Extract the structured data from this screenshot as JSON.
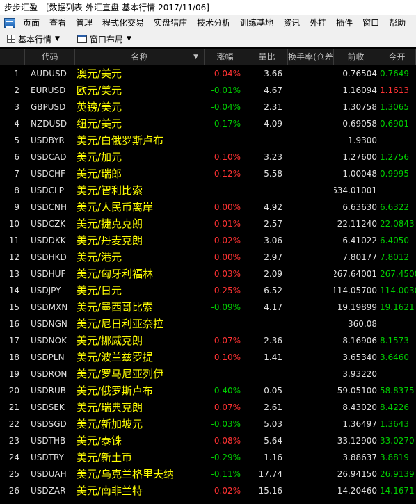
{
  "window": {
    "title": "步步汇盈 - [数据列表-外汇直盘-基本行情 2017/11/06]"
  },
  "menu": {
    "items": [
      "页面",
      "查看",
      "管理",
      "程式化交易",
      "实盘猎庄",
      "技术分析",
      "训练基地",
      "资讯",
      "外挂",
      "插件",
      "窗口",
      "帮助"
    ]
  },
  "toolbar": {
    "quote_label": "基本行情",
    "layout_label": "窗口布局"
  },
  "table": {
    "headers": {
      "code": "代码",
      "name": "名称",
      "change_pct": "涨幅",
      "volume_ratio": "量比",
      "swap": "换手率(仓差",
      "prev_close": "前收",
      "open": "今开"
    },
    "rows": [
      {
        "idx": "1",
        "code": "AUDUSD",
        "name": "澳元/美元",
        "chg": "0.04%",
        "dir": "up",
        "vr": "3.66",
        "prev": "0.76504",
        "open": "0.7649",
        "odir": "down"
      },
      {
        "idx": "2",
        "code": "EURUSD",
        "name": "欧元/美元",
        "chg": "-0.01%",
        "dir": "down",
        "vr": "4.67",
        "prev": "1.16094",
        "open": "1.1613",
        "odir": "up"
      },
      {
        "idx": "3",
        "code": "GBPUSD",
        "name": "英镑/美元",
        "chg": "-0.04%",
        "dir": "down",
        "vr": "2.31",
        "prev": "1.30758",
        "open": "1.3065",
        "odir": "down"
      },
      {
        "idx": "4",
        "code": "NZDUSD",
        "name": "纽元/美元",
        "chg": "-0.17%",
        "dir": "down",
        "vr": "4.09",
        "prev": "0.69058",
        "open": "0.6901",
        "odir": "down"
      },
      {
        "idx": "5",
        "code": "USDBYR",
        "name": "美元/白俄罗斯卢布",
        "chg": "",
        "dir": "flat",
        "vr": "",
        "prev": "1.9300",
        "open": "",
        "odir": "flat"
      },
      {
        "idx": "6",
        "code": "USDCAD",
        "name": "美元/加元",
        "chg": "0.10%",
        "dir": "up",
        "vr": "3.23",
        "prev": "1.27600",
        "open": "1.2756",
        "odir": "down"
      },
      {
        "idx": "7",
        "code": "USDCHF",
        "name": "美元/瑞郎",
        "chg": "0.12%",
        "dir": "up",
        "vr": "5.58",
        "prev": "1.00048",
        "open": "0.9995",
        "odir": "down"
      },
      {
        "idx": "8",
        "code": "USDCLP",
        "name": "美元/智利比索",
        "chg": "",
        "dir": "flat",
        "vr": "",
        "prev": "634.01001",
        "open": "",
        "odir": "flat"
      },
      {
        "idx": "9",
        "code": "USDCNH",
        "name": "美元/人民币离岸",
        "chg": "0.00%",
        "dir": "up",
        "vr": "4.92",
        "prev": "6.63630",
        "open": "6.6322",
        "odir": "down"
      },
      {
        "idx": "10",
        "code": "USDCZK",
        "name": "美元/捷克克朗",
        "chg": "0.01%",
        "dir": "up",
        "vr": "2.57",
        "prev": "22.11240",
        "open": "22.0843",
        "odir": "down"
      },
      {
        "idx": "11",
        "code": "USDDKK",
        "name": "美元/丹麦克朗",
        "chg": "0.02%",
        "dir": "up",
        "vr": "3.06",
        "prev": "6.41022",
        "open": "6.4050",
        "odir": "down"
      },
      {
        "idx": "12",
        "code": "USDHKD",
        "name": "美元/港元",
        "chg": "0.00%",
        "dir": "up",
        "vr": "2.97",
        "prev": "7.80177",
        "open": "7.8012",
        "odir": "down"
      },
      {
        "idx": "13",
        "code": "USDHUF",
        "name": "美元/匈牙利福林",
        "chg": "0.03%",
        "dir": "up",
        "vr": "2.09",
        "prev": "267.64001",
        "open": "267.4500",
        "odir": "down"
      },
      {
        "idx": "14",
        "code": "USDJPY",
        "name": "美元/日元",
        "chg": "0.25%",
        "dir": "up",
        "vr": "6.52",
        "prev": "114.05700",
        "open": "114.0030",
        "odir": "down"
      },
      {
        "idx": "15",
        "code": "USDMXN",
        "name": "美元/墨西哥比索",
        "chg": "-0.09%",
        "dir": "down",
        "vr": "4.17",
        "prev": "19.19899",
        "open": "19.1621",
        "odir": "down"
      },
      {
        "idx": "16",
        "code": "USDNGN",
        "name": "美元/尼日利亚奈拉",
        "chg": "",
        "dir": "flat",
        "vr": "",
        "prev": "360.08",
        "open": "",
        "odir": "flat"
      },
      {
        "idx": "17",
        "code": "USDNOK",
        "name": "美元/挪威克朗",
        "chg": "0.07%",
        "dir": "up",
        "vr": "2.36",
        "prev": "8.16906",
        "open": "8.1573",
        "odir": "down"
      },
      {
        "idx": "18",
        "code": "USDPLN",
        "name": "美元/波兰兹罗提",
        "chg": "0.10%",
        "dir": "up",
        "vr": "1.41",
        "prev": "3.65340",
        "open": "3.6460",
        "odir": "down"
      },
      {
        "idx": "19",
        "code": "USDRON",
        "name": "美元/罗马尼亚列伊",
        "chg": "",
        "dir": "flat",
        "vr": "",
        "prev": "3.93220",
        "open": "",
        "odir": "flat"
      },
      {
        "idx": "20",
        "code": "USDRUB",
        "name": "美元/俄罗斯卢布",
        "chg": "-0.40%",
        "dir": "down",
        "vr": "0.05",
        "prev": "59.05100",
        "open": "58.8375",
        "odir": "down"
      },
      {
        "idx": "21",
        "code": "USDSEK",
        "name": "美元/瑞典克朗",
        "chg": "0.07%",
        "dir": "up",
        "vr": "2.61",
        "prev": "8.43020",
        "open": "8.4226",
        "odir": "down"
      },
      {
        "idx": "22",
        "code": "USDSGD",
        "name": "美元/新加坡元",
        "chg": "-0.03%",
        "dir": "down",
        "vr": "5.03",
        "prev": "1.36497",
        "open": "1.3643",
        "odir": "down"
      },
      {
        "idx": "23",
        "code": "USDTHB",
        "name": "美元/泰铢",
        "chg": "0.08%",
        "dir": "up",
        "vr": "5.64",
        "prev": "33.12900",
        "open": "33.0270",
        "odir": "down"
      },
      {
        "idx": "24",
        "code": "USDTRY",
        "name": "美元/新土币",
        "chg": "-0.29%",
        "dir": "down",
        "vr": "1.16",
        "prev": "3.88637",
        "open": "3.8819",
        "odir": "down"
      },
      {
        "idx": "25",
        "code": "USDUAH",
        "name": "美元/乌克兰格里夫纳",
        "chg": "-0.11%",
        "dir": "down",
        "vr": "17.74",
        "prev": "26.94150",
        "open": "26.9139",
        "odir": "down"
      },
      {
        "idx": "26",
        "code": "USDZAR",
        "name": "美元/南非兰特",
        "chg": "0.02%",
        "dir": "up",
        "vr": "15.16",
        "prev": "14.20460",
        "open": "14.1671",
        "odir": "down"
      }
    ]
  },
  "colors": {
    "up": "#ff3232",
    "down": "#00d000",
    "name": "#ffff00",
    "bg": "#000000"
  }
}
